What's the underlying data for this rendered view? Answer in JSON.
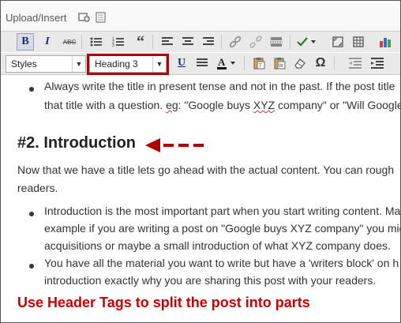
{
  "upload": {
    "label": "Upload/Insert"
  },
  "toolbar": {
    "row1": [
      {
        "name": "bold-button",
        "glyph": "B",
        "active": true
      },
      {
        "name": "italic-button",
        "glyph": "I"
      },
      {
        "name": "strikethrough-button",
        "glyph": "ABC"
      },
      {
        "name": "unordered-list-button",
        "glyph": "☰"
      },
      {
        "name": "ordered-list-button",
        "glyph": "☷"
      },
      {
        "name": "blockquote-button",
        "glyph": "“"
      },
      {
        "name": "align-left-button",
        "glyph": "≡"
      },
      {
        "name": "align-center-button",
        "glyph": "≡"
      },
      {
        "name": "align-right-button",
        "glyph": "≡"
      },
      {
        "name": "insert-link-button",
        "glyph": "🔗"
      },
      {
        "name": "unlink-button",
        "glyph": "⛓"
      },
      {
        "name": "insert-more-button",
        "glyph": "▭"
      },
      {
        "name": "spellcheck-button",
        "glyph": "✓▾"
      },
      {
        "name": "fullscreen-button",
        "glyph": "⛶"
      },
      {
        "name": "kitchen-sink-button",
        "glyph": "▦"
      },
      {
        "name": "chart-button",
        "glyph": "▮"
      }
    ],
    "row2": [
      {
        "name": "underline-button",
        "glyph": "U"
      },
      {
        "name": "justify-button",
        "glyph": "≣"
      },
      {
        "name": "text-color-button",
        "glyph": "A▾"
      },
      {
        "name": "paste-text-button",
        "glyph": "📋"
      },
      {
        "name": "paste-word-button",
        "glyph": "W"
      },
      {
        "name": "remove-format-button",
        "glyph": "⌫"
      },
      {
        "name": "special-char-button",
        "glyph": "Ω"
      },
      {
        "name": "outdent-button",
        "glyph": "⇤"
      },
      {
        "name": "indent-button",
        "glyph": "⇥"
      }
    ],
    "styles_value": "Styles",
    "format_value": "Heading 3"
  },
  "content": {
    "bullet1_line1": "Always write the title in present tense and not in the past. If the post title",
    "bullet1_line2_pre": "that title with a question. ",
    "bullet1_eg": "eg",
    "bullet1_line2_mid": ": \"Google buys ",
    "bullet1_xyz": "XYZ",
    "bullet1_line2_post": " company\" or \"Will Google",
    "heading": "#2. Introduction",
    "para_line1": "Now that we have a title lets go ahead with the actual content. You can rough",
    "para_line2": "readers.",
    "bullet2_line1": "Introduction is the most important part when you start writing content. Ma",
    "bullet2_line2": "example if you are writing a post on \"Google buys XYZ company\" you mig",
    "bullet2_line3": "acquisitions or maybe a small introduction of what XYZ company does.",
    "bullet3_line1": "You have all the material you want to write but have a 'writers block' on h",
    "bullet3_line2": "introduction exactly why you are sharing this post with your readers."
  },
  "caption": "Use Header Tags to split the post into parts",
  "colors": {
    "annotation_red": "#b10000",
    "caption_red": "#cc0000"
  }
}
